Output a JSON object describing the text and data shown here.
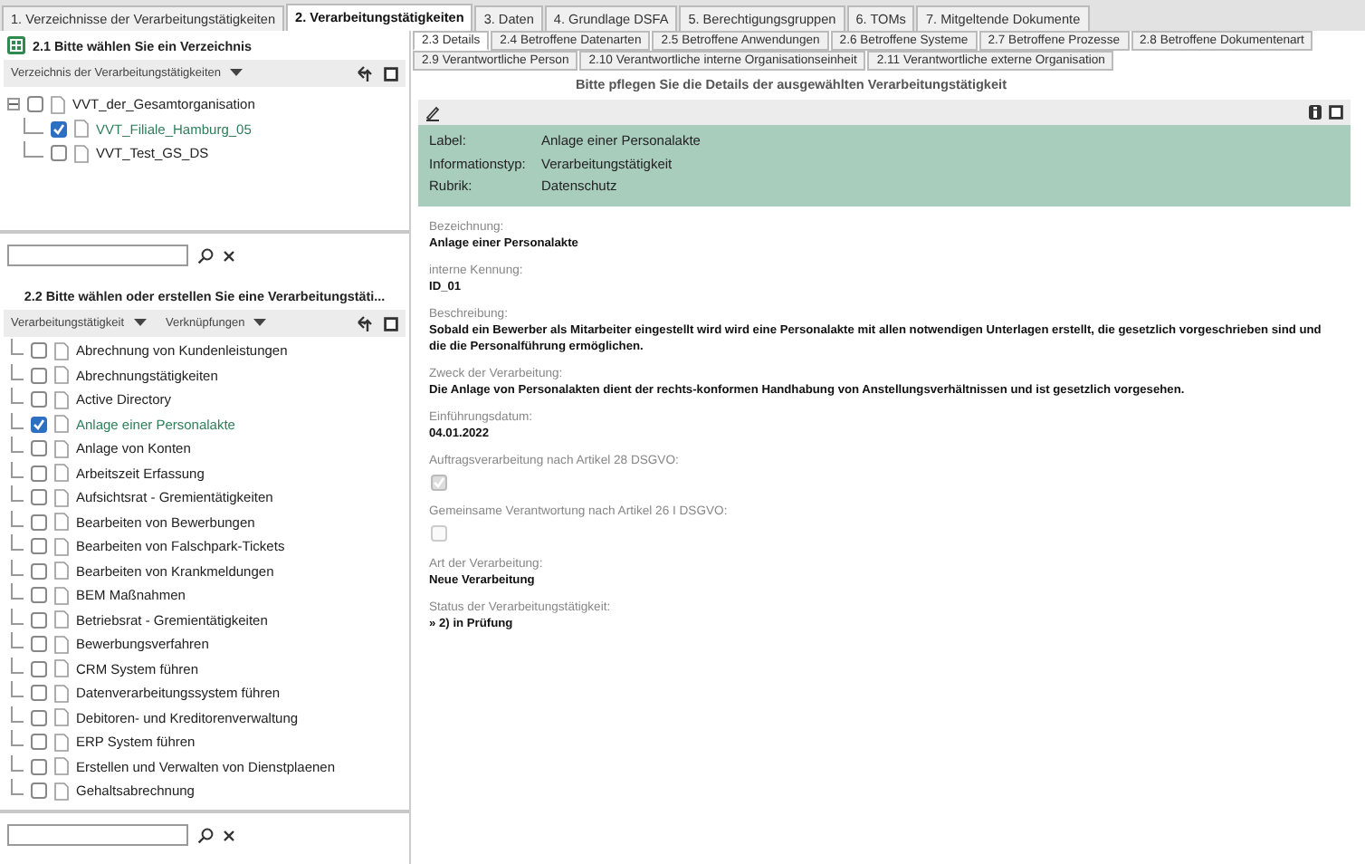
{
  "main_tabs": [
    {
      "label": "1. Verzeichnisse der Verarbeitungstätigkeiten",
      "selected": false
    },
    {
      "label": "2. Verarbeitungstätigkeiten",
      "selected": true
    },
    {
      "label": "3. Daten",
      "selected": false
    },
    {
      "label": "4. Grundlage DSFA",
      "selected": false
    },
    {
      "label": "5. Berechtigungsgruppen",
      "selected": false
    },
    {
      "label": "6. TOMs",
      "selected": false
    },
    {
      "label": "7. Mitgeltende Dokumente",
      "selected": false
    }
  ],
  "directory_panel": {
    "title": "2.1 Bitte wählen Sie ein Verzeichnis",
    "toolbar_menus": [
      "Verzeichnis der Verarbeitungstätigkeiten"
    ],
    "tree": [
      {
        "label": "VVT_der_Gesamtorganisation",
        "checked": false,
        "selected": false,
        "expanded": true,
        "children": [
          {
            "label": "VVT_Filiale_Hamburg_05",
            "checked": true,
            "selected": true
          },
          {
            "label": "VVT_Test_GS_DS",
            "checked": false,
            "selected": false
          }
        ]
      }
    ]
  },
  "activity_panel": {
    "title": "2.2 Bitte wählen oder erstellen Sie eine Verarbeitungstäti...",
    "toolbar_menus": [
      "Verarbeitungstätigkeit",
      "Verknüpfungen"
    ],
    "items": [
      {
        "label": "Abrechnung von Kundenleistungen",
        "checked": false,
        "selected": false
      },
      {
        "label": "Abrechnungstätigkeiten",
        "checked": false,
        "selected": false
      },
      {
        "label": "Active Directory",
        "checked": false,
        "selected": false
      },
      {
        "label": "Anlage einer Personalakte",
        "checked": true,
        "selected": true
      },
      {
        "label": "Anlage von Konten",
        "checked": false,
        "selected": false
      },
      {
        "label": "Arbeitszeit Erfassung",
        "checked": false,
        "selected": false
      },
      {
        "label": "Aufsichtsrat - Gremientätigkeiten",
        "checked": false,
        "selected": false
      },
      {
        "label": "Bearbeiten von Bewerbungen",
        "checked": false,
        "selected": false
      },
      {
        "label": "Bearbeiten von Falschpark-Tickets",
        "checked": false,
        "selected": false
      },
      {
        "label": "Bearbeiten von Krankmeldungen",
        "checked": false,
        "selected": false
      },
      {
        "label": "BEM Maßnahmen",
        "checked": false,
        "selected": false
      },
      {
        "label": "Betriebsrat - Gremientätigkeiten",
        "checked": false,
        "selected": false
      },
      {
        "label": "Bewerbungsverfahren",
        "checked": false,
        "selected": false
      },
      {
        "label": "CRM System führen",
        "checked": false,
        "selected": false
      },
      {
        "label": "Datenverarbeitungssystem führen",
        "checked": false,
        "selected": false
      },
      {
        "label": "Debitoren- und Kreditorenverwaltung",
        "checked": false,
        "selected": false
      },
      {
        "label": "ERP System führen",
        "checked": false,
        "selected": false
      },
      {
        "label": "Erstellen und Verwalten von Dienstplaenen",
        "checked": false,
        "selected": false
      },
      {
        "label": "Gehaltsabrechnung",
        "checked": false,
        "selected": false
      }
    ]
  },
  "detail_tabs": [
    [
      {
        "label": "2.3 Details",
        "selected": true
      },
      {
        "label": "2.4 Betroffene Datenarten",
        "selected": false
      },
      {
        "label": "2.5 Betroffene Anwendungen",
        "selected": false
      },
      {
        "label": "2.6 Betroffene Systeme",
        "selected": false
      },
      {
        "label": "2.7 Betroffene Prozesse",
        "selected": false
      },
      {
        "label": "2.8 Betroffene Dokumentenart",
        "selected": false
      }
    ],
    [
      {
        "label": "2.9 Verantwortliche Person",
        "selected": false
      },
      {
        "label": "2.10 Verantwortliche interne Organisationseinheit",
        "selected": false
      },
      {
        "label": "2.11 Verantwortliche externe Organisation",
        "selected": false
      }
    ]
  ],
  "details": {
    "heading": "Bitte pflegen Sie die Details der ausgewählten Verarbeitungstätigkeit",
    "summary": [
      {
        "label": "Label:",
        "value": "Anlage einer Personalakte"
      },
      {
        "label": "Informationstyp:",
        "value": "Verarbeitungstätigkeit"
      },
      {
        "label": "Rubrik:",
        "value": "Datenschutz"
      }
    ],
    "fields": [
      {
        "kind": "text",
        "label": "Bezeichnung:",
        "value": "Anlage einer Personalakte"
      },
      {
        "kind": "text",
        "label": "interne Kennung:",
        "value": "ID_01"
      },
      {
        "kind": "text",
        "label": "Beschreibung:",
        "value": "Sobald ein Bewerber als Mitarbeiter eingestellt wird wird eine Personalakte mit allen notwendigen Unterlagen erstellt, die gesetzlich vorgeschrieben sind und die die Personalführung ermöglichen."
      },
      {
        "kind": "text",
        "label": "Zweck der Verarbeitung:",
        "value": "Die Anlage von Personalakten dient der rechts-konformen Handhabung von Anstellungsverhältnissen und ist gesetzlich vorgesehen."
      },
      {
        "kind": "text",
        "label": "Einführungsdatum:",
        "value": "04.01.2022"
      },
      {
        "kind": "checkbox",
        "label": "Auftragsverarbeitung nach Artikel 28 DSGVO:",
        "checked": true
      },
      {
        "kind": "checkbox",
        "label": "Gemeinsame Verantwortung nach Artikel 26 I DSGVO:",
        "checked": false
      },
      {
        "kind": "text",
        "label": "Art der Verarbeitung:",
        "value": "Neue Verarbeitung"
      },
      {
        "kind": "text",
        "label": "Status der Verarbeitungstätigkeit:",
        "value": "» 2) in Prüfung"
      }
    ]
  }
}
